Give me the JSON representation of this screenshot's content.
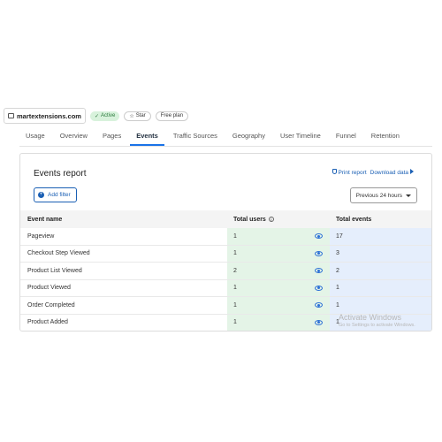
{
  "header": {
    "site_name": "martextensions.com",
    "status": "Active",
    "star_label": "Star",
    "plan": "Free plan"
  },
  "tabs": [
    {
      "label": "Usage"
    },
    {
      "label": "Overview"
    },
    {
      "label": "Pages"
    },
    {
      "label": "Events",
      "active": true
    },
    {
      "label": "Traffic Sources"
    },
    {
      "label": "Geography"
    },
    {
      "label": "User Timeline"
    },
    {
      "label": "Funnel"
    },
    {
      "label": "Retention"
    }
  ],
  "report": {
    "title": "Events report",
    "print_label": "Print report",
    "download_label": "Download data",
    "add_filter_label": "Add filter",
    "range_label": "Previous 24 hours"
  },
  "table": {
    "headers": {
      "name": "Event name",
      "users": "Total users",
      "events": "Total events"
    },
    "rows": [
      {
        "name": "Pageview",
        "users": "1",
        "events": "17"
      },
      {
        "name": "Checkout Step Viewed",
        "users": "1",
        "events": "3"
      },
      {
        "name": "Product List Viewed",
        "users": "2",
        "events": "2"
      },
      {
        "name": "Product Viewed",
        "users": "1",
        "events": "1"
      },
      {
        "name": "Order Completed",
        "users": "1",
        "events": "1"
      },
      {
        "name": "Product Added",
        "users": "1",
        "events": "1"
      }
    ]
  },
  "watermark": {
    "title": "Activate Windows",
    "subtitle": "Go to Settings to activate Windows."
  },
  "colors": {
    "accent": "#1a73e8",
    "link": "#1a5fb4",
    "active_badge_bg": "#d8f2dc",
    "users_column_bg": "#e4f4e7",
    "events_column_bg": "#e5eefc"
  }
}
